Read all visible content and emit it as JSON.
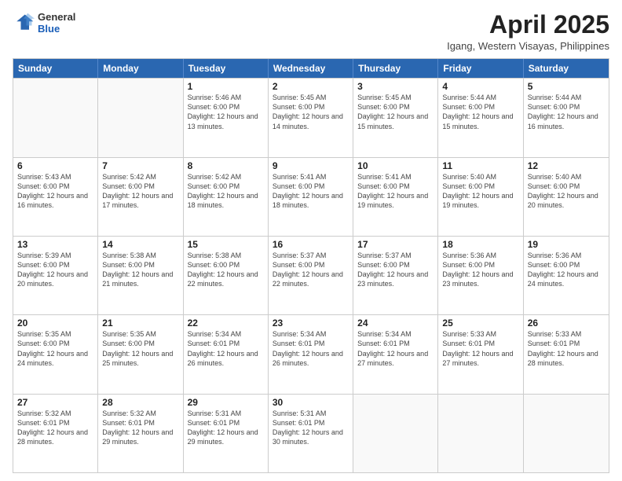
{
  "header": {
    "logo_line1": "General",
    "logo_line2": "Blue",
    "month_title": "April 2025",
    "location": "Igang, Western Visayas, Philippines"
  },
  "weekdays": [
    "Sunday",
    "Monday",
    "Tuesday",
    "Wednesday",
    "Thursday",
    "Friday",
    "Saturday"
  ],
  "weeks": [
    [
      {
        "day": "",
        "info": ""
      },
      {
        "day": "",
        "info": ""
      },
      {
        "day": "1",
        "info": "Sunrise: 5:46 AM\nSunset: 6:00 PM\nDaylight: 12 hours and 13 minutes."
      },
      {
        "day": "2",
        "info": "Sunrise: 5:45 AM\nSunset: 6:00 PM\nDaylight: 12 hours and 14 minutes."
      },
      {
        "day": "3",
        "info": "Sunrise: 5:45 AM\nSunset: 6:00 PM\nDaylight: 12 hours and 15 minutes."
      },
      {
        "day": "4",
        "info": "Sunrise: 5:44 AM\nSunset: 6:00 PM\nDaylight: 12 hours and 15 minutes."
      },
      {
        "day": "5",
        "info": "Sunrise: 5:44 AM\nSunset: 6:00 PM\nDaylight: 12 hours and 16 minutes."
      }
    ],
    [
      {
        "day": "6",
        "info": "Sunrise: 5:43 AM\nSunset: 6:00 PM\nDaylight: 12 hours and 16 minutes."
      },
      {
        "day": "7",
        "info": "Sunrise: 5:42 AM\nSunset: 6:00 PM\nDaylight: 12 hours and 17 minutes."
      },
      {
        "day": "8",
        "info": "Sunrise: 5:42 AM\nSunset: 6:00 PM\nDaylight: 12 hours and 18 minutes."
      },
      {
        "day": "9",
        "info": "Sunrise: 5:41 AM\nSunset: 6:00 PM\nDaylight: 12 hours and 18 minutes."
      },
      {
        "day": "10",
        "info": "Sunrise: 5:41 AM\nSunset: 6:00 PM\nDaylight: 12 hours and 19 minutes."
      },
      {
        "day": "11",
        "info": "Sunrise: 5:40 AM\nSunset: 6:00 PM\nDaylight: 12 hours and 19 minutes."
      },
      {
        "day": "12",
        "info": "Sunrise: 5:40 AM\nSunset: 6:00 PM\nDaylight: 12 hours and 20 minutes."
      }
    ],
    [
      {
        "day": "13",
        "info": "Sunrise: 5:39 AM\nSunset: 6:00 PM\nDaylight: 12 hours and 20 minutes."
      },
      {
        "day": "14",
        "info": "Sunrise: 5:38 AM\nSunset: 6:00 PM\nDaylight: 12 hours and 21 minutes."
      },
      {
        "day": "15",
        "info": "Sunrise: 5:38 AM\nSunset: 6:00 PM\nDaylight: 12 hours and 22 minutes."
      },
      {
        "day": "16",
        "info": "Sunrise: 5:37 AM\nSunset: 6:00 PM\nDaylight: 12 hours and 22 minutes."
      },
      {
        "day": "17",
        "info": "Sunrise: 5:37 AM\nSunset: 6:00 PM\nDaylight: 12 hours and 23 minutes."
      },
      {
        "day": "18",
        "info": "Sunrise: 5:36 AM\nSunset: 6:00 PM\nDaylight: 12 hours and 23 minutes."
      },
      {
        "day": "19",
        "info": "Sunrise: 5:36 AM\nSunset: 6:00 PM\nDaylight: 12 hours and 24 minutes."
      }
    ],
    [
      {
        "day": "20",
        "info": "Sunrise: 5:35 AM\nSunset: 6:00 PM\nDaylight: 12 hours and 24 minutes."
      },
      {
        "day": "21",
        "info": "Sunrise: 5:35 AM\nSunset: 6:00 PM\nDaylight: 12 hours and 25 minutes."
      },
      {
        "day": "22",
        "info": "Sunrise: 5:34 AM\nSunset: 6:01 PM\nDaylight: 12 hours and 26 minutes."
      },
      {
        "day": "23",
        "info": "Sunrise: 5:34 AM\nSunset: 6:01 PM\nDaylight: 12 hours and 26 minutes."
      },
      {
        "day": "24",
        "info": "Sunrise: 5:34 AM\nSunset: 6:01 PM\nDaylight: 12 hours and 27 minutes."
      },
      {
        "day": "25",
        "info": "Sunrise: 5:33 AM\nSunset: 6:01 PM\nDaylight: 12 hours and 27 minutes."
      },
      {
        "day": "26",
        "info": "Sunrise: 5:33 AM\nSunset: 6:01 PM\nDaylight: 12 hours and 28 minutes."
      }
    ],
    [
      {
        "day": "27",
        "info": "Sunrise: 5:32 AM\nSunset: 6:01 PM\nDaylight: 12 hours and 28 minutes."
      },
      {
        "day": "28",
        "info": "Sunrise: 5:32 AM\nSunset: 6:01 PM\nDaylight: 12 hours and 29 minutes."
      },
      {
        "day": "29",
        "info": "Sunrise: 5:31 AM\nSunset: 6:01 PM\nDaylight: 12 hours and 29 minutes."
      },
      {
        "day": "30",
        "info": "Sunrise: 5:31 AM\nSunset: 6:01 PM\nDaylight: 12 hours and 30 minutes."
      },
      {
        "day": "",
        "info": ""
      },
      {
        "day": "",
        "info": ""
      },
      {
        "day": "",
        "info": ""
      }
    ]
  ]
}
